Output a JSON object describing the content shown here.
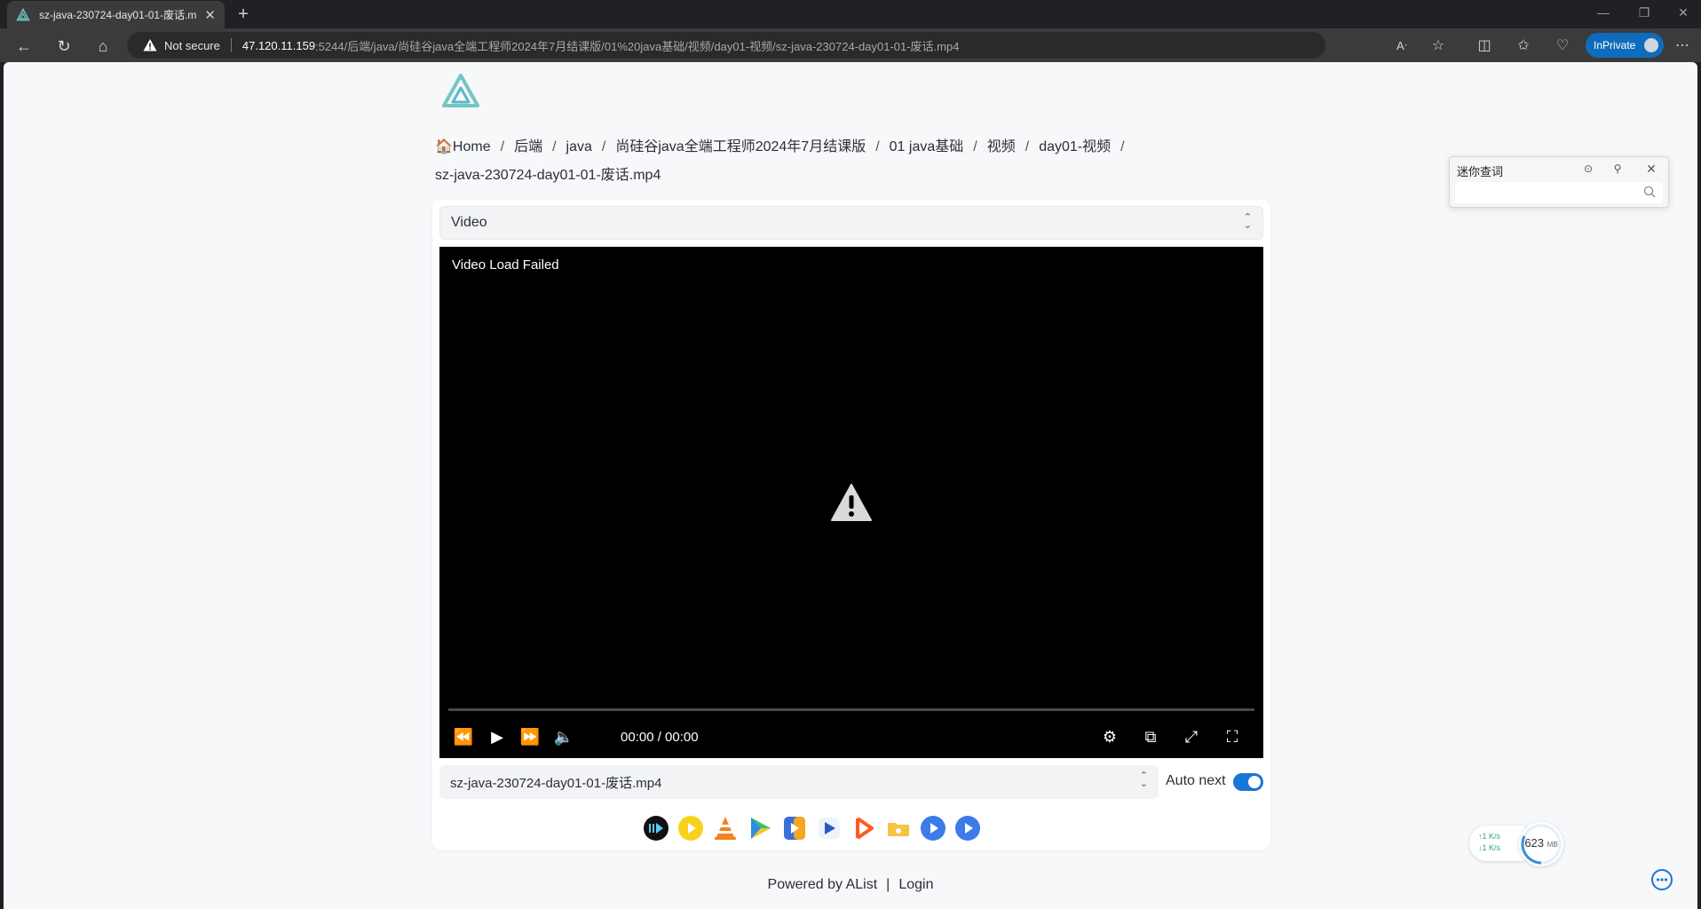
{
  "browser": {
    "tab_title": "sz-java-230724-day01-01-废话.mp4",
    "new_tab_symbol": "+",
    "url_security": "Not secure",
    "url_host": "47.120.11.159",
    "url_path": ":5244/后端/java/尚硅谷java全端工程师2024年7月结课版/01%20java基础/视频/day01-视频/sz-java-230724-day01-01-废话.mp4",
    "inprivate_label": "InPrivate",
    "accent_color": "#0f6cbd"
  },
  "breadcrumb": {
    "home": "🏠Home",
    "items": [
      "后端",
      "java",
      "尚硅谷java全端工程师2024年7月结课版",
      "01 java基础",
      "视频",
      "day01-视频"
    ],
    "current": "sz-java-230724-day01-01-废话.mp4",
    "separator": "/"
  },
  "preview": {
    "mode_select": "Video"
  },
  "player": {
    "error_text": "Video Load Failed",
    "time": "00:00 / 00:00"
  },
  "playlist": {
    "current_file": "sz-java-230724-day01-01-废话.mp4",
    "auto_next_label": "Auto next",
    "auto_next_on": true,
    "toggle_color": "#1677d6"
  },
  "external_players": [
    "iina-icon",
    "potplayer-icon",
    "vlc-icon",
    "nplayer-icon",
    "omniplayer-icon",
    "figplayer-icon",
    "infuse-icon",
    "mx-player-icon",
    "mx-player-pro-icon",
    "fileball-icon"
  ],
  "footer": {
    "powered_by": "Powered by AList",
    "separator": "|",
    "login": "Login"
  },
  "mini_dict": {
    "title": "迷你查词"
  },
  "net_monitor": {
    "upload": "↑1  K/s",
    "download": "↓1  K/s",
    "memory_value": "623",
    "memory_unit": "MB"
  }
}
